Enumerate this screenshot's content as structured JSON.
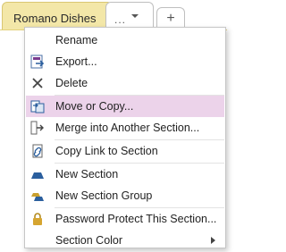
{
  "tabs": {
    "active_label": "Romano Dishes",
    "more_dots": "...",
    "add_label": "+"
  },
  "menu": {
    "items": [
      {
        "label": "Rename",
        "icon": "rename-icon"
      },
      {
        "label": "Export...",
        "icon": "export-icon"
      },
      {
        "label": "Delete",
        "icon": "delete-x-icon"
      },
      {
        "label": "Move or Copy...",
        "icon": "move-copy-icon",
        "highlighted": true
      },
      {
        "label": "Merge into Another Section...",
        "icon": "merge-icon"
      },
      {
        "label": "Copy Link to Section",
        "icon": "link-icon"
      },
      {
        "label": "New Section",
        "icon": "new-section-icon"
      },
      {
        "label": "New Section Group",
        "icon": "new-section-group-icon"
      },
      {
        "label": "Password Protect This Section...",
        "icon": "lock-icon"
      },
      {
        "label": "Section Color",
        "icon": "none",
        "has_submenu": true
      }
    ]
  },
  "colors": {
    "active_tab": "#f3e7a8",
    "highlight": "#ecd3ea",
    "icon_blue": "#2b5f9e",
    "icon_purple": "#7a3b8f",
    "icon_gold": "#d6a530"
  }
}
